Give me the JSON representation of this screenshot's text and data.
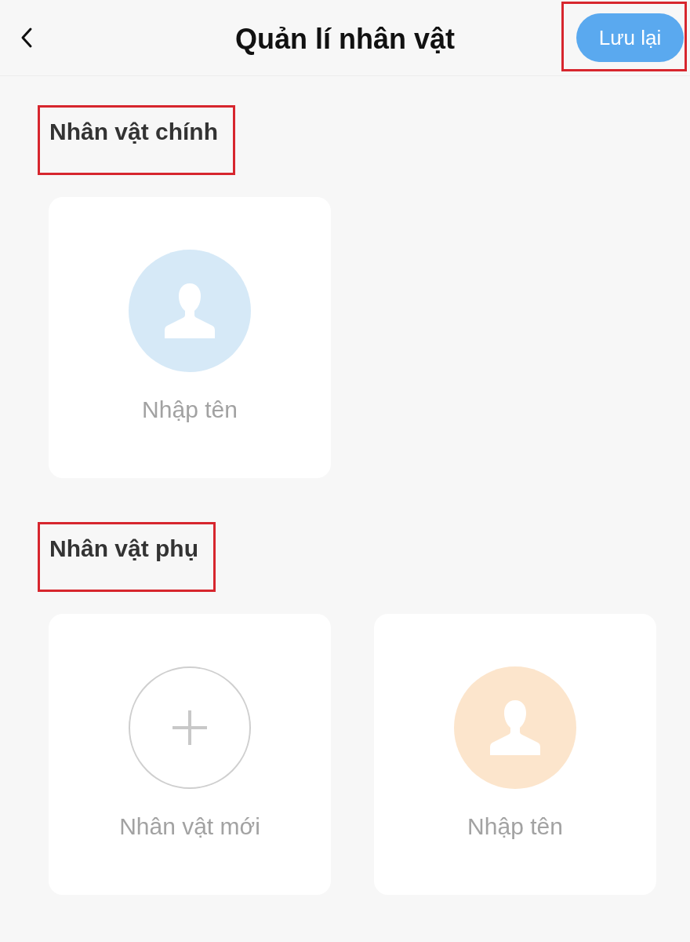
{
  "header": {
    "title": "Quản lí nhân vật",
    "save_button": {
      "label": "Lưu lại",
      "highlighted": true
    }
  },
  "sections": [
    {
      "title": "Nhân vật chính",
      "highlighted": true,
      "cards": [
        {
          "kind": "character",
          "color": "#d6e9f7",
          "placeholder": "Nhập tên"
        }
      ]
    },
    {
      "title": "Nhân vật phụ",
      "highlighted": true,
      "cards": [
        {
          "kind": "add",
          "label": "Nhân vật mới"
        },
        {
          "kind": "character",
          "color": "#fce5cc",
          "placeholder": "Nhập tên"
        }
      ]
    }
  ]
}
